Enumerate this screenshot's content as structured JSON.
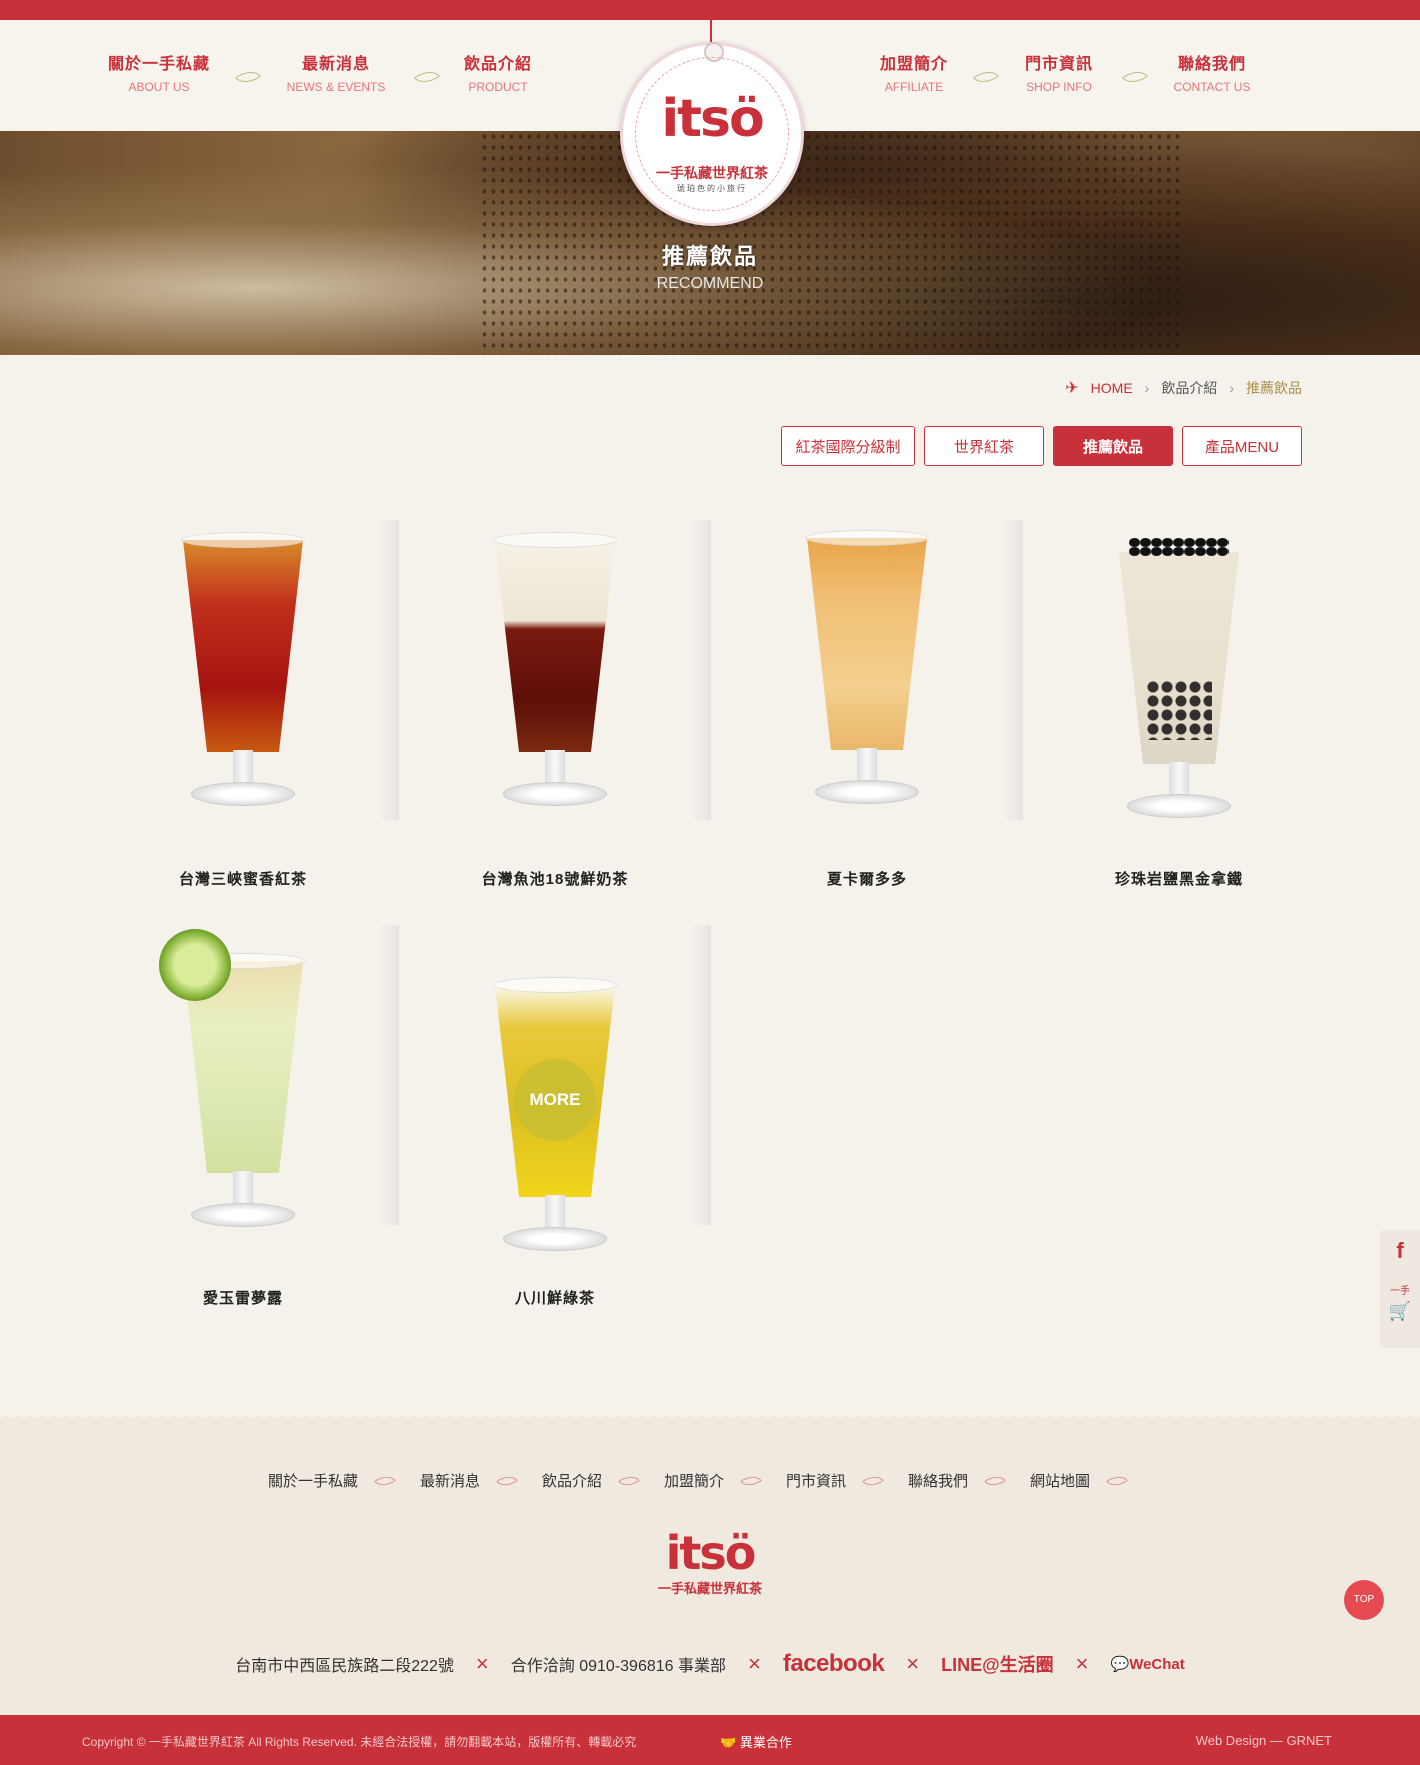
{
  "nav_left": [
    {
      "zh": "關於一手私藏",
      "en": "ABOUT US"
    },
    {
      "zh": "最新消息",
      "en": "NEWS & EVENTS"
    },
    {
      "zh": "飲品介紹",
      "en": "PRODUCT"
    }
  ],
  "nav_right": [
    {
      "zh": "加盟簡介",
      "en": "AFFILIATE"
    },
    {
      "zh": "門市資訊",
      "en": "SHOP INFO"
    },
    {
      "zh": "聯絡我們",
      "en": "CONTACT US"
    }
  ],
  "logo": {
    "word": "itsö",
    "subtitle": "一手私藏世界紅茶",
    "tagline": "琥珀色的小旅行"
  },
  "hero": {
    "title": "推薦飲品",
    "subtitle": "RECOMMEND"
  },
  "breadcrumb": {
    "home": "HOME",
    "level1": "飲品介紹",
    "current": "推薦飲品"
  },
  "tabs": [
    "紅茶國際分級制",
    "世界紅茶",
    "推薦飲品",
    "產品MENU"
  ],
  "products": [
    {
      "name": "台灣三峽蜜香紅茶"
    },
    {
      "name": "台灣魚池18號鮮奶茶"
    },
    {
      "name": "夏卡爾多多"
    },
    {
      "name": "珍珠岩鹽黑金拿鐵"
    },
    {
      "name": "愛玉雷夢露"
    },
    {
      "name": "八川鮮綠茶"
    }
  ],
  "more_label": "MORE",
  "side": {
    "fb": "f",
    "label": "一手"
  },
  "footer_nav": [
    "關於一手私藏",
    "最新消息",
    "飲品介紹",
    "加盟簡介",
    "門市資訊",
    "聯絡我們",
    "網站地圖"
  ],
  "footer_info": {
    "address": "台南市中西區民族路二段222號",
    "contact": "合作洽詢 0910-396816 事業部",
    "facebook": "facebook",
    "line": "LINE@生活圈",
    "wechat": "WeChat"
  },
  "totop": "TOP",
  "bottombar": {
    "copyright": "Copyright © 一手私藏世界紅茶 All Rights Reserved. 未經合法授權，請勿翻載本站，版權所有、轉載必究",
    "partner": "異業合作",
    "design": "Web Design — GRNET"
  },
  "colors": {
    "brand_red": "#c8313a",
    "accent_gold": "#a88f4a",
    "leaf_green": "#b8bf7a"
  }
}
